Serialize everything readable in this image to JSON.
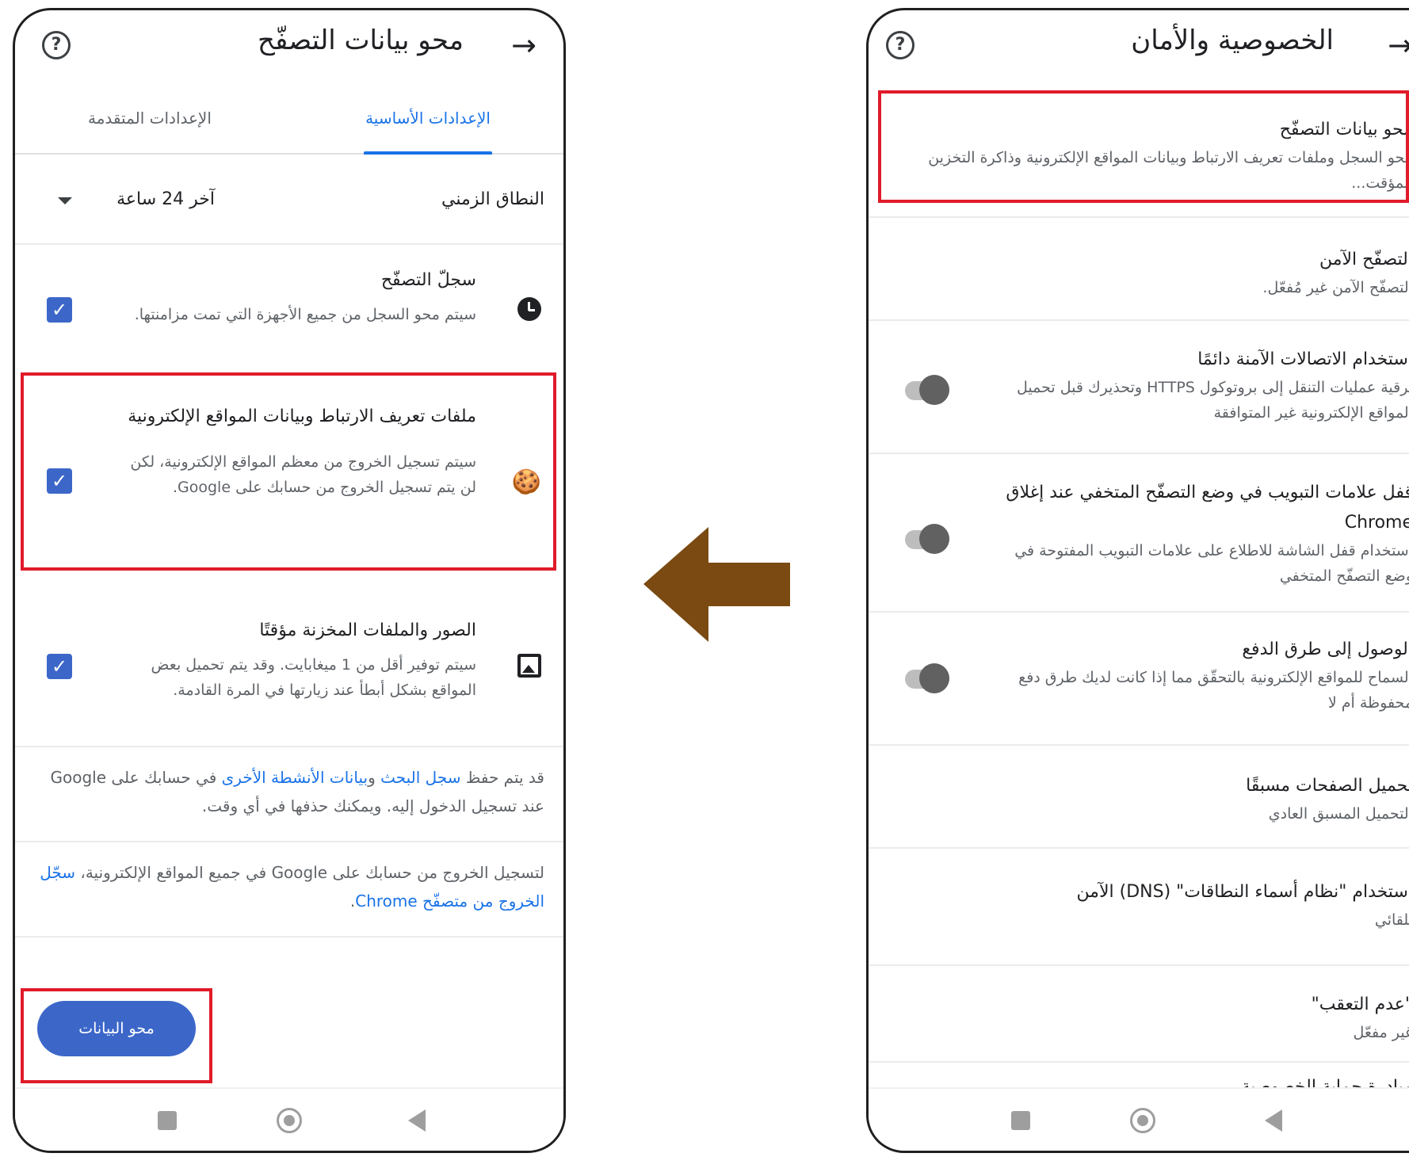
{
  "left_screen": {
    "title": "محو بيانات التصفّح",
    "tabs": {
      "basic": "الإعدادات الأساسية",
      "advanced": "الإعدادات المتقدمة"
    },
    "time_range": {
      "label": "النطاق الزمني",
      "value": "آخر 24 ساعة"
    },
    "items": [
      {
        "title": "سجلّ التصفّح",
        "desc": "سيتم محو السجل من جميع الأجهزة التي تمت مزامنتها.",
        "icon": "clock-icon",
        "checked": true
      },
      {
        "title": "ملفات تعريف الارتباط وبيانات المواقع الإلكترونية",
        "desc": "سيتم تسجيل الخروج من معظم المواقع الإلكترونية، لكن لن يتم تسجيل الخروج من حسابك على Google.",
        "icon": "cookie-icon",
        "checked": true
      },
      {
        "title": "الصور والملفات المخزنة مؤقتًا",
        "desc": "سيتم توفير أقل من 1 ميغابايت. وقد يتم تحميل بعض المواقع بشكل أبطأ عند زيارتها في المرة القادمة.",
        "icon": "image-icon",
        "checked": true
      }
    ],
    "info1": {
      "prefix": "قد يتم حفظ ",
      "link1": "سجل البحث",
      "mid": " و",
      "link2": "بيانات الأنشطة الأخرى",
      "suffix": " في حسابك على Google عند تسجيل الدخول إليه. ويمكنك حذفها في أي وقت."
    },
    "info2": {
      "prefix": "لتسجيل الخروج من حسابك على Google في جميع المواقع الإلكترونية، ",
      "link": "سجّل الخروج من متصفّح Chrome",
      "suffix": "."
    },
    "clear_button": "محو البيانات"
  },
  "right_screen": {
    "title": "الخصوصية والأمان",
    "items": [
      {
        "title": "محو بيانات التصفّح",
        "desc": "محو السجل وملفات تعريف الارتباط وبيانات المواقع الإلكترونية وذاكرة التخزين المؤقت..."
      },
      {
        "title": "التصفّح الآمن",
        "desc": "التصفّح الآمن غير مُفعّل."
      },
      {
        "title": "استخدام الاتصالات الآمنة دائمًا",
        "desc": "ترقية عمليات التنقل إلى بروتوكول HTTPS وتحذيرك قبل تحميل المواقع الإلكترونية غير المتوافقة",
        "toggle": "off"
      },
      {
        "title": "قفل علامات التبويب في وضع التصفّح المتخفي عند إغلاق Chrome",
        "desc": "استخدام قفل الشاشة للاطلاع على علامات التبويب المفتوحة في وضع التصفّح المتخفي",
        "toggle": "off"
      },
      {
        "title": "الوصول إلى طرق الدفع",
        "desc": "السماح للمواقع الإلكترونية بالتحقّق مما إذا كانت لديك طرق دفع محفوظة أم لا",
        "toggle": "off"
      },
      {
        "title": "تحميل الصفحات مسبقًا",
        "desc": "التحميل المسبق العادي"
      },
      {
        "title": "استخدام \"نظام أسماء النطاقات\" (DNS) الآمن",
        "desc": "تلقائي"
      },
      {
        "title": "\"عدم التعقب\"",
        "desc": "غير مفعّل"
      },
      {
        "title": "مبادرة حماية الخصوصية",
        "desc": ""
      }
    ]
  },
  "arrow": {
    "direction": "left",
    "color": "#7a4a12"
  },
  "colors": {
    "accent": "#1a73e8",
    "checkbox": "#3c67c9",
    "highlight": "#e01b2a"
  }
}
